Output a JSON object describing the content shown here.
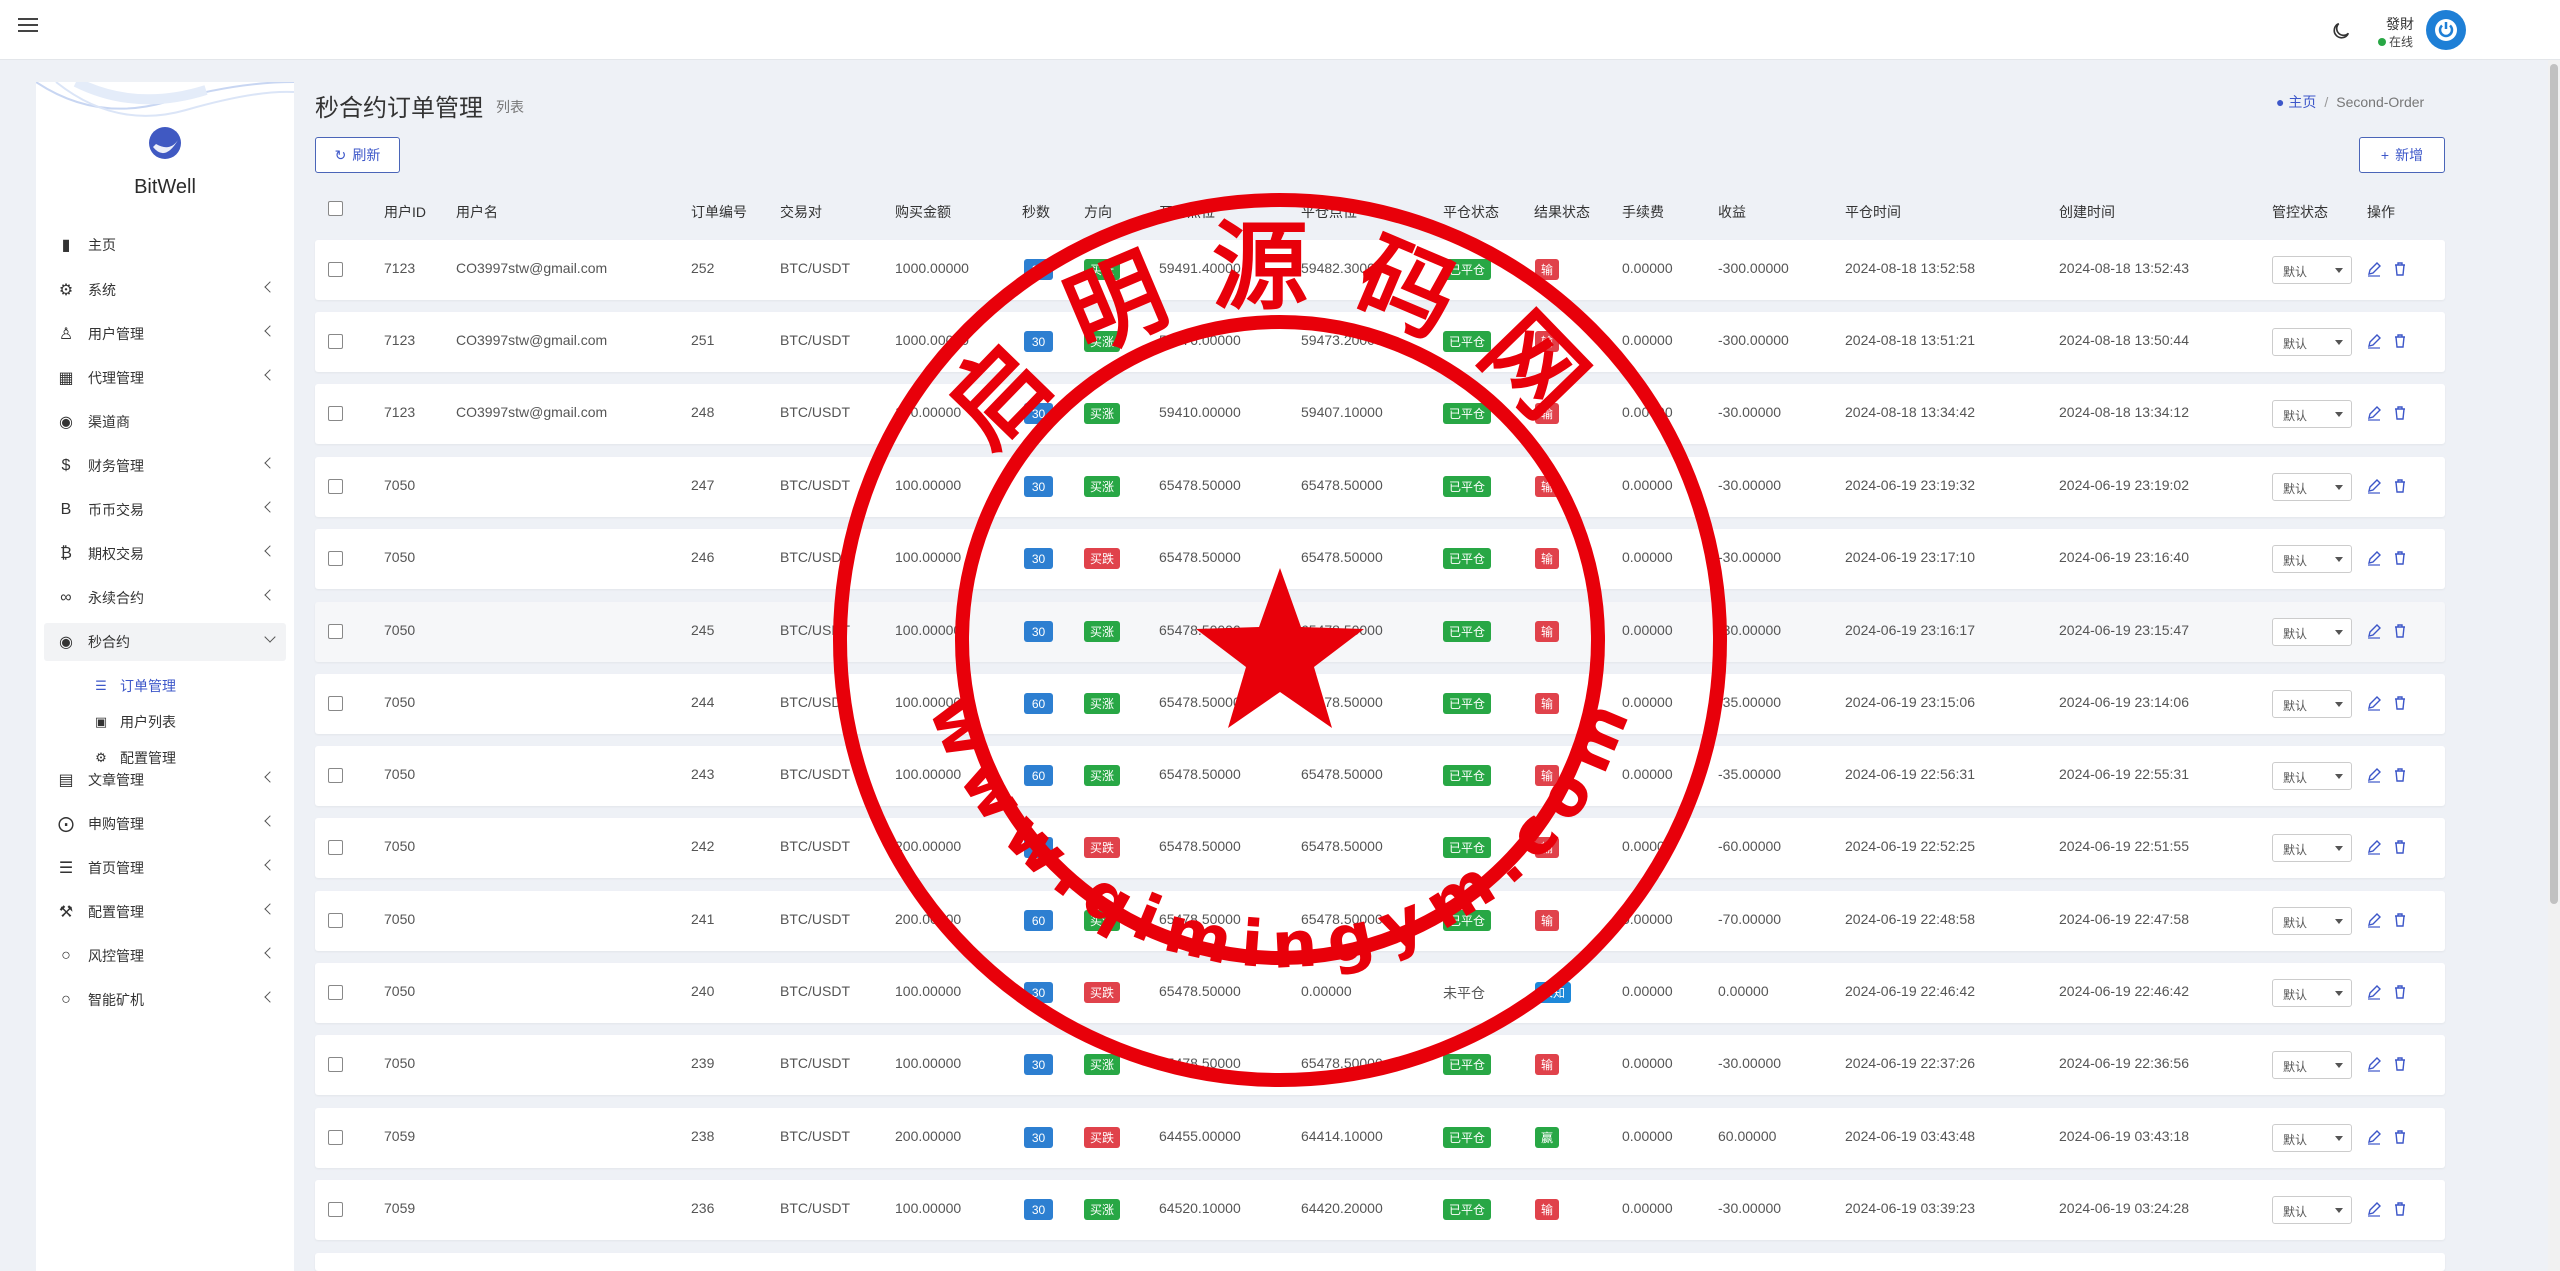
{
  "header": {
    "username": "發財",
    "status": "在线"
  },
  "sidebar": {
    "brand": "BitWell",
    "items": [
      {
        "label": "主页",
        "icon": "chart-icon",
        "has_children": false
      },
      {
        "label": "系统",
        "icon": "gear-icon",
        "has_children": true
      },
      {
        "label": "用户管理",
        "icon": "users-icon",
        "has_children": true
      },
      {
        "label": "代理管理",
        "icon": "id-card-icon",
        "has_children": true
      },
      {
        "label": "渠道商",
        "icon": "user-circle-icon",
        "has_children": false
      },
      {
        "label": "财务管理",
        "icon": "dollar-icon",
        "has_children": true
      },
      {
        "label": "币币交易",
        "icon": "bitcoin-b-icon",
        "has_children": true
      },
      {
        "label": "期权交易",
        "icon": "bitcoin-icon",
        "has_children": true
      },
      {
        "label": "永续合约",
        "icon": "link-icon",
        "has_children": true
      },
      {
        "label": "秒合约",
        "icon": "dot-circle-icon",
        "has_children": true,
        "expanded": true
      },
      {
        "label": "文章管理",
        "icon": "newspaper-icon",
        "has_children": true
      },
      {
        "label": "申购管理",
        "icon": "lifebuoy-icon",
        "has_children": true
      },
      {
        "label": "首页管理",
        "icon": "bars-icon",
        "has_children": true
      },
      {
        "label": "配置管理",
        "icon": "wrench-icon",
        "has_children": true
      },
      {
        "label": "风控管理",
        "icon": "circle-icon",
        "has_children": true
      },
      {
        "label": "智能矿机",
        "icon": "circle-icon",
        "has_children": true
      }
    ],
    "sub_items": [
      {
        "label": "订单管理",
        "icon": "list-icon",
        "active": true
      },
      {
        "label": "用户列表",
        "icon": "portrait-icon",
        "active": false
      },
      {
        "label": "配置管理",
        "icon": "cog-icon",
        "active": false
      }
    ]
  },
  "page": {
    "title": "秒合约订单管理",
    "subtitle": "列表"
  },
  "breadcrumb": {
    "home": "主页",
    "current": "Second-Order"
  },
  "toolbar": {
    "refresh_label": "刷新",
    "add_label": "新增"
  },
  "table": {
    "columns": [
      "用户ID",
      "用户名",
      "订单编号",
      "交易对",
      "购买金额",
      "秒数",
      "方向",
      "开仓点位",
      "平仓点位",
      "平仓状态",
      "结果状态",
      "手续费",
      "收益",
      "平仓时间",
      "创建时间",
      "管控状态",
      "操作"
    ],
    "control_default": "默认",
    "rows": [
      {
        "uid": "7123",
        "name": "CO3997stw@gmail.com",
        "order": "252",
        "pair": "BTC/USDT",
        "amount": "1000.00000",
        "sec": "30",
        "dir": "买涨",
        "open": "59491.40000",
        "close": "59482.30000",
        "cstatus": "已平仓",
        "result": "输",
        "fee": "0.00000",
        "profit": "-300.00000",
        "ctime": "2024-08-18 13:52:58",
        "created": "2024-08-18 13:52:43"
      },
      {
        "uid": "7123",
        "name": "CO3997stw@gmail.com",
        "order": "251",
        "pair": "BTC/USDT",
        "amount": "1000.00000",
        "sec": "30",
        "dir": "买涨",
        "open": "59476.00000",
        "close": "59473.20000",
        "cstatus": "已平仓",
        "result": "输",
        "fee": "0.00000",
        "profit": "-300.00000",
        "ctime": "2024-08-18 13:51:21",
        "created": "2024-08-18 13:50:44"
      },
      {
        "uid": "7123",
        "name": "CO3997stw@gmail.com",
        "order": "248",
        "pair": "BTC/USDT",
        "amount": "100.00000",
        "sec": "30",
        "dir": "买涨",
        "open": "59410.00000",
        "close": "59407.10000",
        "cstatus": "已平仓",
        "result": "输",
        "fee": "0.00000",
        "profit": "-30.00000",
        "ctime": "2024-08-18 13:34:42",
        "created": "2024-08-18 13:34:12"
      },
      {
        "uid": "7050",
        "name": "",
        "order": "247",
        "pair": "BTC/USDT",
        "amount": "100.00000",
        "sec": "30",
        "dir": "买涨",
        "open": "65478.50000",
        "close": "65478.50000",
        "cstatus": "已平仓",
        "result": "输",
        "fee": "0.00000",
        "profit": "-30.00000",
        "ctime": "2024-06-19 23:19:32",
        "created": "2024-06-19 23:19:02"
      },
      {
        "uid": "7050",
        "name": "",
        "order": "246",
        "pair": "BTC/USDT",
        "amount": "100.00000",
        "sec": "30",
        "dir": "买跌",
        "open": "65478.50000",
        "close": "65478.50000",
        "cstatus": "已平仓",
        "result": "输",
        "fee": "0.00000",
        "profit": "-30.00000",
        "ctime": "2024-06-19 23:17:10",
        "created": "2024-06-19 23:16:40"
      },
      {
        "uid": "7050",
        "name": "",
        "order": "245",
        "pair": "BTC/USDT",
        "amount": "100.00000",
        "sec": "30",
        "dir": "买涨",
        "open": "65478.50000",
        "close": "65478.50000",
        "cstatus": "已平仓",
        "result": "输",
        "fee": "0.00000",
        "profit": "-30.00000",
        "ctime": "2024-06-19 23:16:17",
        "created": "2024-06-19 23:15:47"
      },
      {
        "uid": "7050",
        "name": "",
        "order": "244",
        "pair": "BTC/USDT",
        "amount": "100.00000",
        "sec": "60",
        "dir": "买涨",
        "open": "65478.50000",
        "close": "65478.50000",
        "cstatus": "已平仓",
        "result": "输",
        "fee": "0.00000",
        "profit": "-35.00000",
        "ctime": "2024-06-19 23:15:06",
        "created": "2024-06-19 23:14:06"
      },
      {
        "uid": "7050",
        "name": "",
        "order": "243",
        "pair": "BTC/USDT",
        "amount": "100.00000",
        "sec": "60",
        "dir": "买涨",
        "open": "65478.50000",
        "close": "65478.50000",
        "cstatus": "已平仓",
        "result": "输",
        "fee": "0.00000",
        "profit": "-35.00000",
        "ctime": "2024-06-19 22:56:31",
        "created": "2024-06-19 22:55:31"
      },
      {
        "uid": "7050",
        "name": "",
        "order": "242",
        "pair": "BTC/USDT",
        "amount": "200.00000",
        "sec": "30",
        "dir": "买跌",
        "open": "65478.50000",
        "close": "65478.50000",
        "cstatus": "已平仓",
        "result": "输",
        "fee": "0.00000",
        "profit": "-60.00000",
        "ctime": "2024-06-19 22:52:25",
        "created": "2024-06-19 22:51:55"
      },
      {
        "uid": "7050",
        "name": "",
        "order": "241",
        "pair": "BTC/USDT",
        "amount": "200.00000",
        "sec": "60",
        "dir": "买涨",
        "open": "65478.50000",
        "close": "65478.50000",
        "cstatus": "已平仓",
        "result": "输",
        "fee": "0.00000",
        "profit": "-70.00000",
        "ctime": "2024-06-19 22:48:58",
        "created": "2024-06-19 22:47:58"
      },
      {
        "uid": "7050",
        "name": "",
        "order": "240",
        "pair": "BTC/USDT",
        "amount": "100.00000",
        "sec": "30",
        "dir": "买跌",
        "open": "65478.50000",
        "close": "0.00000",
        "cstatus": "未平仓",
        "result": "未知",
        "fee": "0.00000",
        "profit": "0.00000",
        "ctime": "2024-06-19 22:46:42",
        "created": "2024-06-19 22:46:42"
      },
      {
        "uid": "7050",
        "name": "",
        "order": "239",
        "pair": "BTC/USDT",
        "amount": "100.00000",
        "sec": "30",
        "dir": "买涨",
        "open": "65478.50000",
        "close": "65478.50000",
        "cstatus": "已平仓",
        "result": "输",
        "fee": "0.00000",
        "profit": "-30.00000",
        "ctime": "2024-06-19 22:37:26",
        "created": "2024-06-19 22:36:56"
      },
      {
        "uid": "7059",
        "name": "",
        "order": "238",
        "pair": "BTC/USDT",
        "amount": "200.00000",
        "sec": "30",
        "dir": "买跌",
        "open": "64455.00000",
        "close": "64414.10000",
        "cstatus": "已平仓",
        "result": "赢",
        "fee": "0.00000",
        "profit": "60.00000",
        "ctime": "2024-06-19 03:43:48",
        "created": "2024-06-19 03:43:18"
      },
      {
        "uid": "7059",
        "name": "",
        "order": "236",
        "pair": "BTC/USDT",
        "amount": "100.00000",
        "sec": "30",
        "dir": "买涨",
        "open": "64520.10000",
        "close": "64420.20000",
        "cstatus": "已平仓",
        "result": "输",
        "fee": "0.00000",
        "profit": "-30.00000",
        "ctime": "2024-06-19 03:39:23",
        "created": "2024-06-19 03:24:28"
      }
    ]
  },
  "watermark": {
    "top_text": "启明源码网",
    "bottom_text": "www.qimingym.com",
    "color": "#e8000a"
  }
}
